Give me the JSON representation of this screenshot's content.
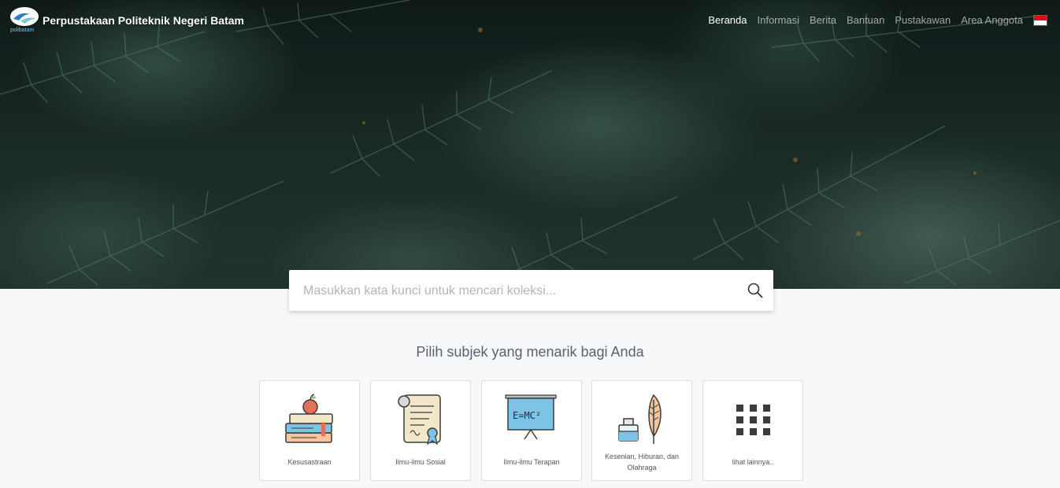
{
  "header": {
    "logo_text": "polibatam",
    "brand": "Perpustakaan Politeknik Negeri Batam",
    "nav": [
      {
        "label": "Beranda",
        "active": true
      },
      {
        "label": "Informasi",
        "active": false
      },
      {
        "label": "Berita",
        "active": false
      },
      {
        "label": "Bantuan",
        "active": false
      },
      {
        "label": "Pustakawan",
        "active": false
      },
      {
        "label": "Area Anggota",
        "active": false
      }
    ],
    "language_flag": "indonesia-flag-icon"
  },
  "search": {
    "placeholder": "Masukkan kata kunci untuk mencari koleksi...",
    "value": "",
    "icon": "search-icon"
  },
  "subjects": {
    "title": "Pilih subjek yang menarik bagi Anda",
    "items": [
      {
        "label": "Kesusastraan",
        "icon": "books-apple-icon"
      },
      {
        "label": "Ilmu-ilmu Sosial",
        "icon": "certificate-scroll-icon"
      },
      {
        "label": "Ilmu-ilmu Terapan",
        "icon": "formula-board-icon"
      },
      {
        "label": "Kesenian, Hiburan, dan Olahraga",
        "icon": "ink-quill-icon"
      },
      {
        "label": "lihat lainnya..",
        "icon": "grid-icon"
      }
    ]
  },
  "colors": {
    "accent_blue": "#7cc3e6",
    "hero_dark": "#1a2a25",
    "background": "#f7f8fa"
  }
}
